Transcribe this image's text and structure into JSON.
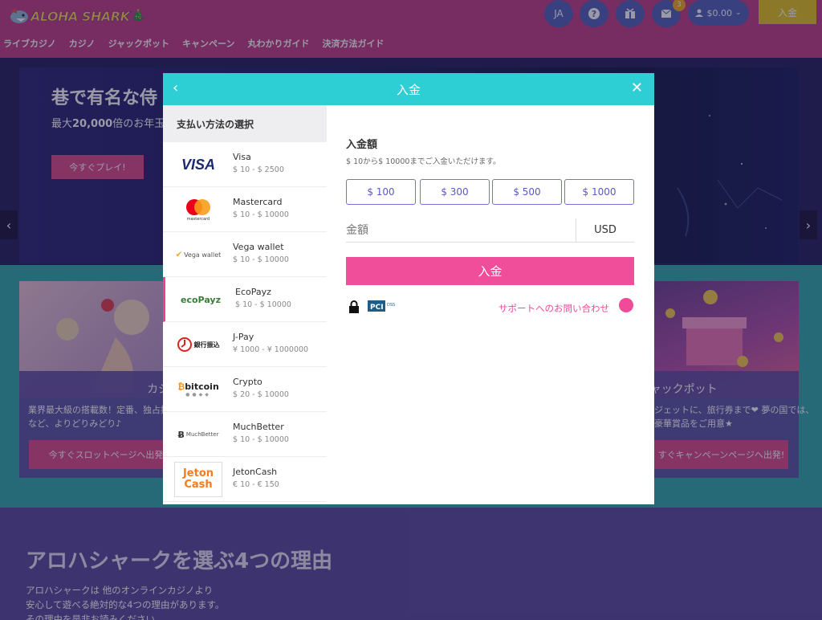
{
  "header": {
    "logo_text": "ALOHA SHARK",
    "nav": [
      "ライブカジノ",
      "カジノ",
      "ジャックポット",
      "キャンペーン",
      "丸わかりガイド",
      "決済方法ガイド"
    ],
    "lang": "JA",
    "notification_count": "3",
    "balance": "$0.00",
    "deposit_label": "入金"
  },
  "hero": {
    "title": "巷で有名な侍",
    "subtitle_bold": "20,000",
    "subtitle_pre": "最大",
    "subtitle_post": "倍のお年玉ウ",
    "cta": "今すぐプレイ!"
  },
  "cards": {
    "left": {
      "title": "カジノ",
      "line1": "業界最大級の搭載数！定番、独占搭",
      "line2": "など、よりどりみどり♪",
      "cta": "今すぐスロットページへ出発"
    },
    "right": {
      "title": "ジャックポット",
      "line1": "ジェットに、旅行券まで❤ 夢の国では、",
      "line2": "豪華賞品をご用意★",
      "cta": "すぐキャンペーンページへ出発!"
    }
  },
  "reasons": {
    "title": "アロハシャークを選ぶ4つの理由",
    "lines": [
      "アロハシャークは 他のオンラインカジノより",
      "安心して遊べる絶対的な4つの理由があります。",
      "その理由を是非お読みください。"
    ]
  },
  "modal": {
    "title": "入金",
    "methods_header": "支払い方法の選択",
    "methods": [
      {
        "name": "Visa",
        "range": "$ 10 - $ 2500",
        "logo": "VISA"
      },
      {
        "name": "Mastercard",
        "range": "$ 10 - $ 10000",
        "logo": "mastercard"
      },
      {
        "name": "Vega wallet",
        "range": "$ 10 - $ 10000",
        "logo": "Vega wallet"
      },
      {
        "name": "EcoPayz",
        "range": "$ 10 - $ 10000",
        "logo": "ecoPayz"
      },
      {
        "name": "J-Pay",
        "range": "¥ 1000 - ¥ 1000000",
        "logo": "銀行振込"
      },
      {
        "name": "Crypto",
        "range": "$ 20 - $ 10000",
        "logo": "bitcoin"
      },
      {
        "name": "MuchBetter",
        "range": "$ 10 - $ 10000",
        "logo": "MuchBetter"
      },
      {
        "name": "JetonCash",
        "range": "€ 10 - € 150",
        "logo": "Jeton Cash"
      }
    ],
    "selected_method": "EcoPayz",
    "amount_label": "入金額",
    "amount_hint": "$ 10から$ 10000までご入金いただけます。",
    "presets": [
      "$ 100",
      "$ 300",
      "$ 500",
      "$ 1000"
    ],
    "amount_placeholder": "金額",
    "currency": "USD",
    "submit_label": "入金",
    "pci_text": "PCI DSS",
    "support_label": "サポートへのお問い合わせ"
  },
  "colors": {
    "header": "#c03a80",
    "modal_head": "#2ecfd4",
    "accent_pink": "#f04d9b",
    "preset_border": "#7372d8",
    "teal": "#2aa8a6",
    "purple": "#57469a"
  }
}
